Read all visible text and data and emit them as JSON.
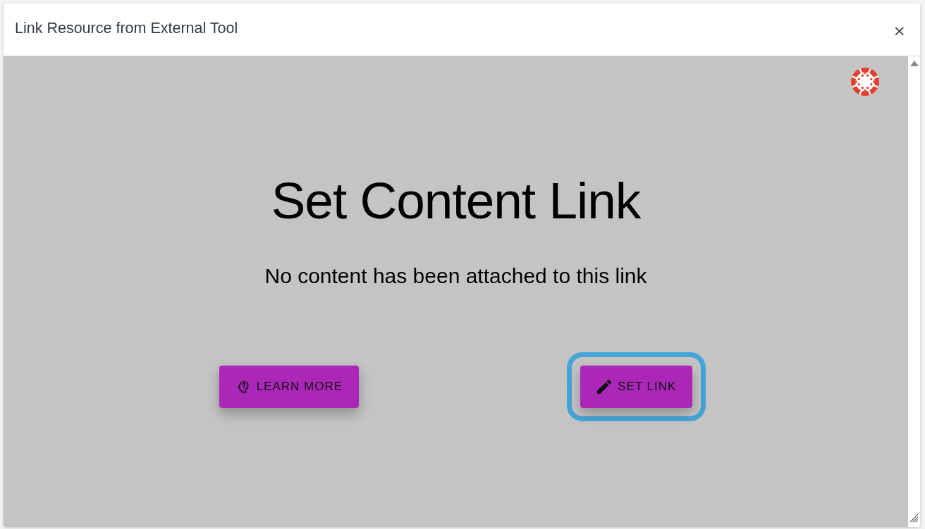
{
  "dialog": {
    "title": "Link Resource from External Tool",
    "close": "×"
  },
  "content": {
    "heading": "Set Content Link",
    "message": "No content has been attached to this link",
    "buttons": [
      {
        "label": "LEARN MORE",
        "kind": "help",
        "focused": false
      },
      {
        "label": "SET LINK",
        "kind": "edit",
        "focused": true
      }
    ]
  }
}
